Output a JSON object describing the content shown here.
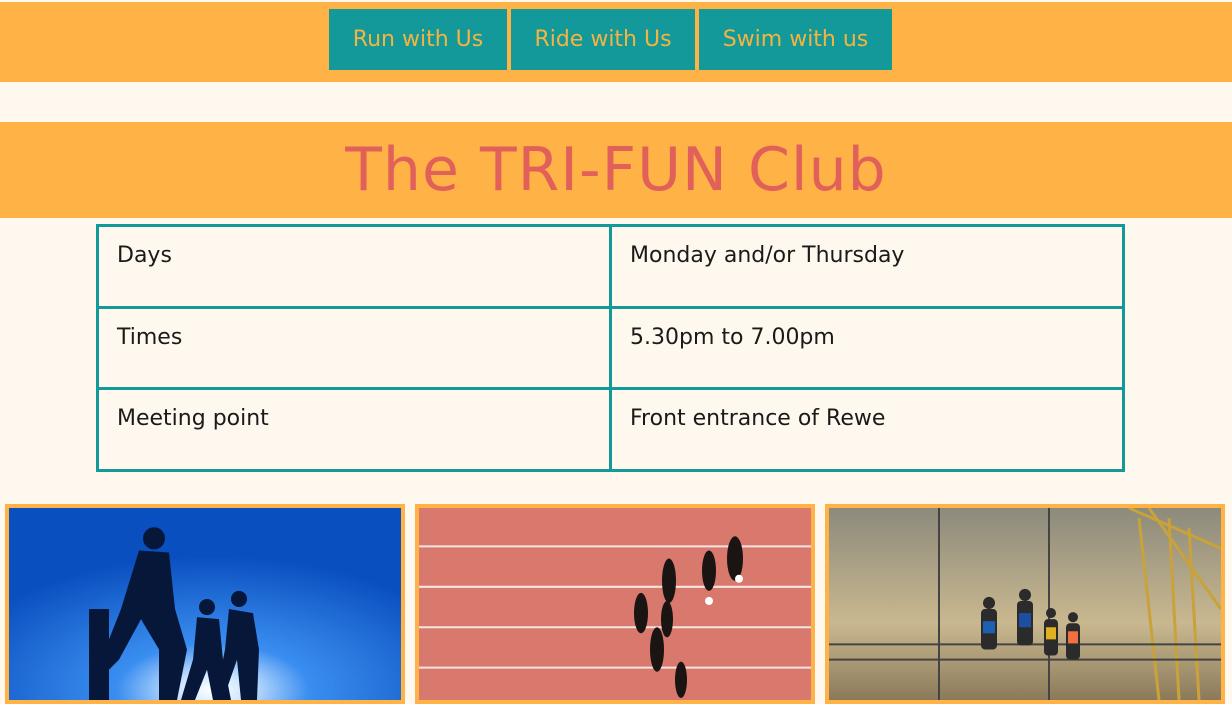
{
  "nav": {
    "items": [
      {
        "label": "Run with Us"
      },
      {
        "label": "Ride with Us"
      },
      {
        "label": "Swim with us"
      }
    ]
  },
  "header": {
    "title": "The TRI-FUN Club"
  },
  "schedule": {
    "rows": [
      {
        "label": "Days",
        "value": "Monday and/or Thursday"
      },
      {
        "label": "Times",
        "value": "5.30pm to 7.00pm"
      },
      {
        "label": "Meeting point",
        "value": "Front entrance of Rewe"
      }
    ]
  },
  "colors": {
    "band": "#ffb347",
    "accent": "#13999a",
    "title": "#e2605a",
    "background": "#fff8ee"
  }
}
